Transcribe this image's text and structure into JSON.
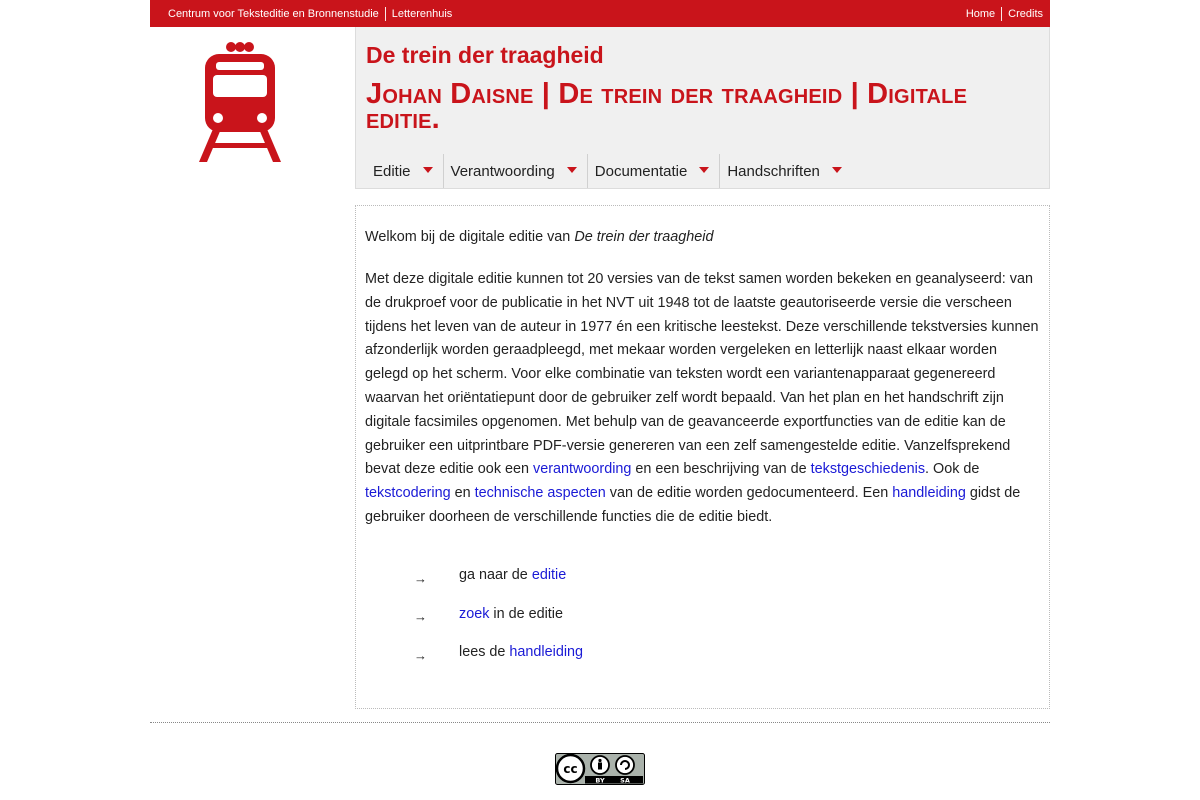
{
  "topbar": {
    "left_links": [
      "Centrum voor Teksteditie en Bronnenstudie",
      "Letterenhuis"
    ],
    "right_links": [
      "Home",
      "Credits"
    ]
  },
  "logo": {
    "icon": "train-icon",
    "color": "#c9141b"
  },
  "header": {
    "site_title": "De trein der traagheid",
    "edition_title": "Johan Daisne | De trein der traagheid | Digitale editie."
  },
  "menu": {
    "items": [
      "Editie",
      "Verantwoording",
      "Documentatie",
      "Handschriften"
    ]
  },
  "content": {
    "welcome_prefix": "Welkom bij de digitale editie van ",
    "welcome_title": "De trein der traagheid",
    "intro_text": "Met deze digitale editie kunnen tot 20 versies van de tekst samen worden bekeken en geanalyseerd: van de drukproef voor de publicatie in het NVT uit 1948 tot de laatste geautoriseerde versie die verscheen tijdens het leven van de auteur in 1977 én een kritische leestekst. Deze verschillende tekstversies kunnen afzonderlijk worden geraadpleegd, met mekaar worden vergeleken en letterlijk naast elkaar worden gelegd op het scherm. Voor elke combinatie van teksten wordt een variantenapparaat gegenereerd waarvan het oriëntatiepunt door de gebruiker zelf wordt bepaald. Van het plan en het handschrift zijn digitale facsimiles opgenomen. Met behulp van de geavanceerde exportfuncties van de editie kan de gebruiker een uitprintbare PDF-versie genereren van een zelf samengestelde editie. Vanzelfsprekend bevat deze editie ook een ",
    "link_verantwoording": "verantwoording",
    "text_2": " en een beschrijving van de ",
    "link_tekstgeschiedenis": "tekstgeschiedenis",
    "text_3": ". Ook de ",
    "link_tekstcodering": "tekstcodering",
    "text_4": " en ",
    "link_technische": "technische aspecten",
    "text_5": " van de editie worden gedocumenteerd. Een ",
    "link_handleiding": "handleiding",
    "text_6": " gidst de gebruiker doorheen de verschillende functies die de editie biedt.",
    "nav": [
      {
        "arrow": "→",
        "before": "ga naar de ",
        "link": "editie",
        "after": ""
      },
      {
        "arrow": "→",
        "before": "",
        "link": "zoek",
        "after": " in de editie"
      },
      {
        "arrow": "→",
        "before": "lees de ",
        "link": "handleiding",
        "after": ""
      }
    ]
  },
  "footer": {
    "license": {
      "icon": "cc-by-sa-badge",
      "by": "BY",
      "sa": "SA"
    }
  },
  "colors": {
    "accent": "#c9141b",
    "link": "#1a1ad6"
  }
}
